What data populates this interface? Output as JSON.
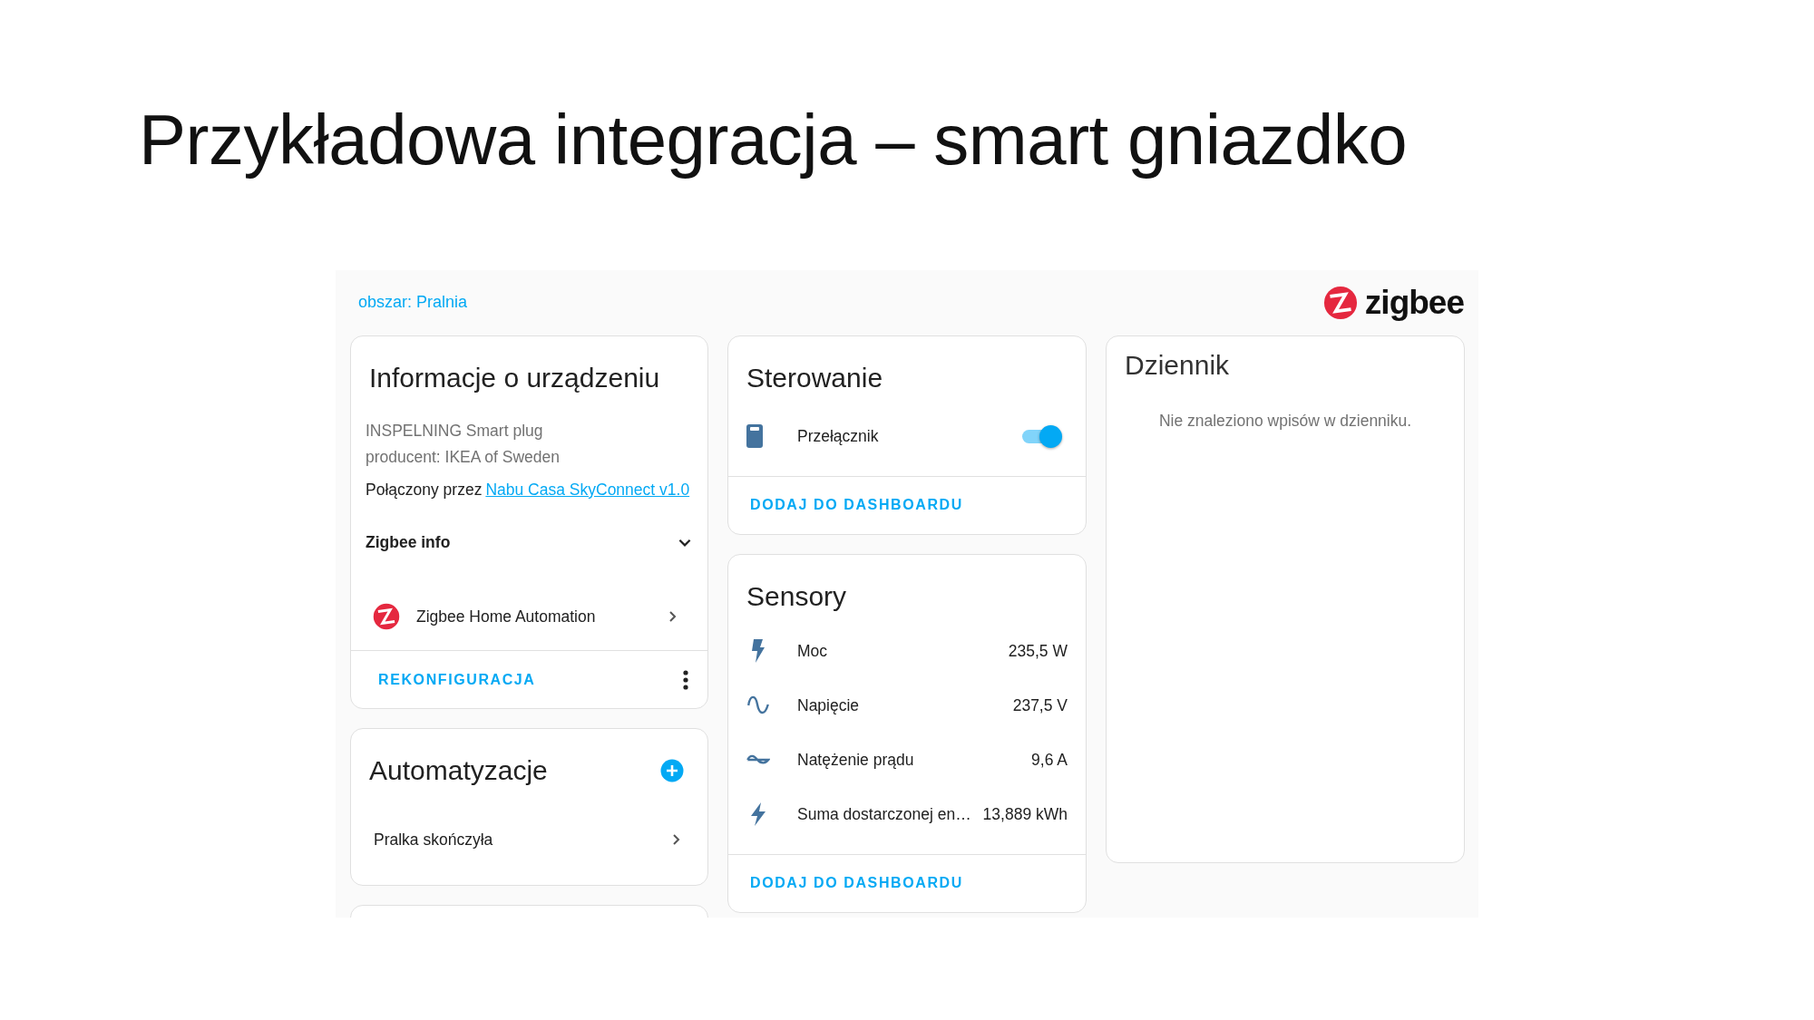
{
  "slide_title": "Przykładowa integracja – smart gniazdko",
  "area_link": "obszar: Pralnia",
  "brand": "zigbee",
  "device_info": {
    "title": "Informacje o urządzeniu",
    "model": "INSPELNING Smart plug",
    "manufacturer": "producent: IKEA of Sweden",
    "connected_prefix": "Połączony przez",
    "connected_link": "Nabu Casa SkyConnect v1.0",
    "section": {
      "label": "Zigbee info",
      "expanded": false
    },
    "integration": "Zigbee Home Automation",
    "action": "REKONFIGURACJA"
  },
  "automations": {
    "title": "Automatyzacje",
    "items": [
      "Pralka skończyła"
    ]
  },
  "controls": {
    "title": "Sterowanie",
    "items": [
      {
        "label": "Przełącznik",
        "on": true
      }
    ],
    "action": "DODAJ DO DASHBOARDU"
  },
  "sensors": {
    "title": "Sensory",
    "items": [
      {
        "label": "Moc",
        "value": "235,5 W"
      },
      {
        "label": "Napięcie",
        "value": "237,5 V"
      },
      {
        "label": "Natężenie prądu",
        "value": "9,6 A"
      },
      {
        "label": "Suma dostarczonej en…",
        "value": "13,889 kWh"
      }
    ],
    "action": "DODAJ DO DASHBOARDU"
  },
  "logbook": {
    "title": "Dziennik",
    "empty_text": "Nie znaleziono wpisów w dzienniku."
  }
}
